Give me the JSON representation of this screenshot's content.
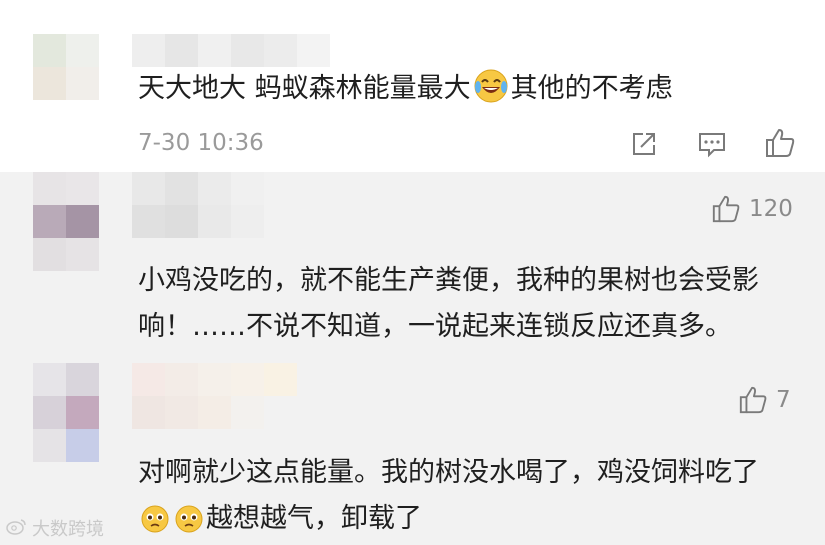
{
  "comments": [
    {
      "text_before_emoji": "天大地大 蚂蚁森林能量最大",
      "text_after_emoji": "其他的不考虑",
      "emoji": "laughing-tears-emoji",
      "time": "7-30 10:36",
      "actions": [
        "share-icon",
        "comment-icon",
        "thumbs-up-icon"
      ]
    },
    {
      "text": "小鸡没吃的，就不能生产粪便，我种的果树也会受影响！……不说不知道，一说起来连锁反应还真多。",
      "likes": "120"
    },
    {
      "text_before_emoji": "对啊就少这点能量。我的树没水喝了，鸡没饲料吃了",
      "text_after_emoji": "越想越气，卸载了",
      "emoji": "pleading-face-emoji",
      "likes": "7"
    }
  ],
  "watermark": "大数跨境",
  "colors": {
    "reply_background": "#f2f2f2",
    "text": "#1f1f1f",
    "muted": "#9a9a9a",
    "icon": "#7a7a7a"
  }
}
